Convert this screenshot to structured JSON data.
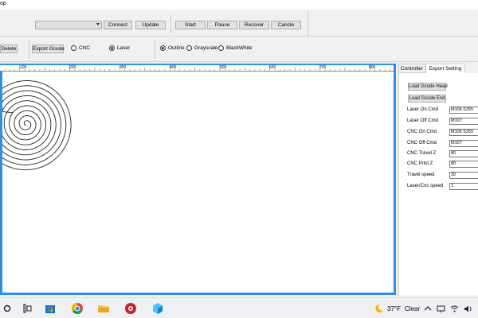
{
  "title_fragment": "op",
  "toolbar": {
    "port_select_value": "",
    "connect": "Connect",
    "update": "Update",
    "start": "Start",
    "pause": "Pause",
    "recover": "Recover",
    "cancel": "Cancle"
  },
  "toolbar2": {
    "delete": "Delete",
    "export_gcode": "Export Gcode",
    "mode_options": [
      {
        "label": "CNC",
        "selected": false
      },
      {
        "label": "Laser",
        "selected": true
      }
    ],
    "render_options": [
      {
        "label": "Outline",
        "selected": true
      },
      {
        "label": "Grayscale",
        "selected": false
      },
      {
        "label": "BlackWhite",
        "selected": false
      }
    ]
  },
  "ruler": {
    "labels": [
      "100",
      "200",
      "300",
      "400",
      "500",
      "600",
      "700",
      "800"
    ]
  },
  "tabs": [
    {
      "label": "Controller",
      "active": false
    },
    {
      "label": "Export Setting",
      "active": true
    }
  ],
  "export_setting": {
    "load_head": "Load Gcode Head",
    "load_end": "Load Gcode End",
    "fields": [
      {
        "label": "Laser On Cmd",
        "value": "M106 S255"
      },
      {
        "label": "Laser Off Cmd",
        "value": "M107"
      },
      {
        "label": "CNC On Cmd",
        "value": "M106 S255"
      },
      {
        "label": "CNC Off Cmd",
        "value": "M107"
      },
      {
        "label": "CNC Travel Z",
        "value": "80"
      },
      {
        "label": "CNC Print Z",
        "value": "80"
      },
      {
        "label": "Travel speed",
        "value": "30"
      },
      {
        "label": "Laser/Cnc speed",
        "value": "1"
      }
    ]
  },
  "taskbar": {
    "icons": [
      "search-icon",
      "task-view-icon",
      "store-icon",
      "chrome-icon",
      "file-explorer-icon",
      "app-red-icon",
      "app-3d-icon"
    ],
    "weather_temp": "37°F",
    "weather_desc": "Clear"
  },
  "colors": {
    "accent": "#2f8fe8",
    "spiral": "#222222"
  }
}
